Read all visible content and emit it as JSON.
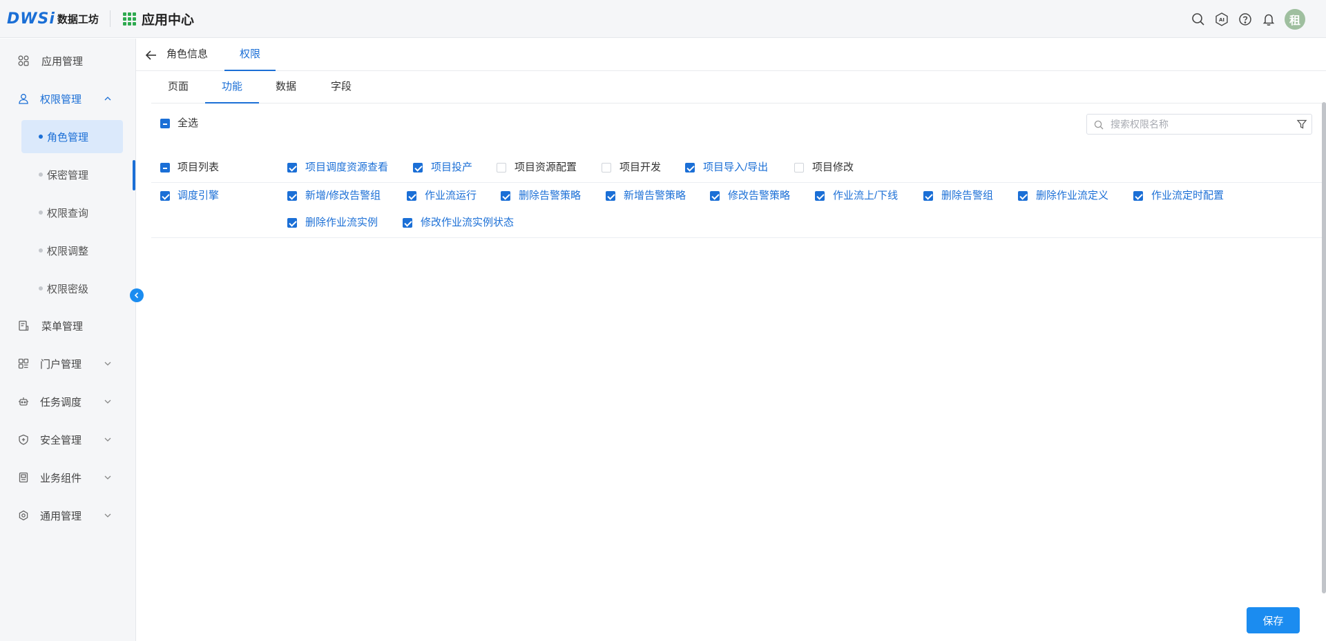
{
  "header": {
    "logo_mark": "DWS",
    "logo_mark_i": "i",
    "logo_text": "数据工坊",
    "app_center": "应用中心",
    "avatar": "租",
    "icons": [
      "search-icon",
      "ai-icon",
      "help-icon",
      "bell-icon"
    ]
  },
  "sidebar": {
    "items": [
      {
        "label": "应用管理",
        "icon": "apps-icon"
      },
      {
        "label": "权限管理",
        "icon": "user-lock-icon"
      },
      {
        "label": "菜单管理",
        "icon": "menu-doc-icon"
      },
      {
        "label": "门户管理",
        "icon": "portal-icon"
      },
      {
        "label": "任务调度",
        "icon": "robot-icon"
      },
      {
        "label": "安全管理",
        "icon": "shield-icon"
      },
      {
        "label": "业务组件",
        "icon": "component-icon"
      },
      {
        "label": "通用管理",
        "icon": "settings-icon"
      }
    ],
    "sub_items": [
      "角色管理",
      "保密管理",
      "权限查询",
      "权限调整",
      "权限密级"
    ]
  },
  "top_tabs": [
    "角色信息",
    "权限"
  ],
  "sub_tabs": [
    "页面",
    "功能",
    "数据",
    "字段"
  ],
  "select_all": "全选",
  "search": {
    "placeholder": "搜索权限名称"
  },
  "rows": [
    {
      "label": "项目列表",
      "state": "indeterminate",
      "items": [
        {
          "label": "项目调度资源查看",
          "checked": true
        },
        {
          "label": "项目投产",
          "checked": true
        },
        {
          "label": "项目资源配置",
          "checked": false
        },
        {
          "label": "项目开发",
          "checked": false
        },
        {
          "label": "项目导入/导出",
          "checked": true
        },
        {
          "label": "项目修改",
          "checked": false
        }
      ]
    },
    {
      "label": "调度引擎",
      "state": "checked",
      "items": [
        {
          "label": "新增/修改告警组",
          "checked": true
        },
        {
          "label": "作业流运行",
          "checked": true
        },
        {
          "label": "删除告警策略",
          "checked": true
        },
        {
          "label": "新增告警策略",
          "checked": true
        },
        {
          "label": "修改告警策略",
          "checked": true
        },
        {
          "label": "作业流上/下线",
          "checked": true
        },
        {
          "label": "删除告警组",
          "checked": true
        },
        {
          "label": "删除作业流定义",
          "checked": true
        },
        {
          "label": "作业流定时配置",
          "checked": true
        },
        {
          "label": "删除作业流实例",
          "checked": true
        },
        {
          "label": "修改作业流实例状态",
          "checked": true
        }
      ]
    }
  ],
  "save_label": "保存",
  "colors": {
    "accent": "#1b6fd6",
    "button": "#1b8cf0",
    "sidebar_bg": "#f5f6f8"
  }
}
